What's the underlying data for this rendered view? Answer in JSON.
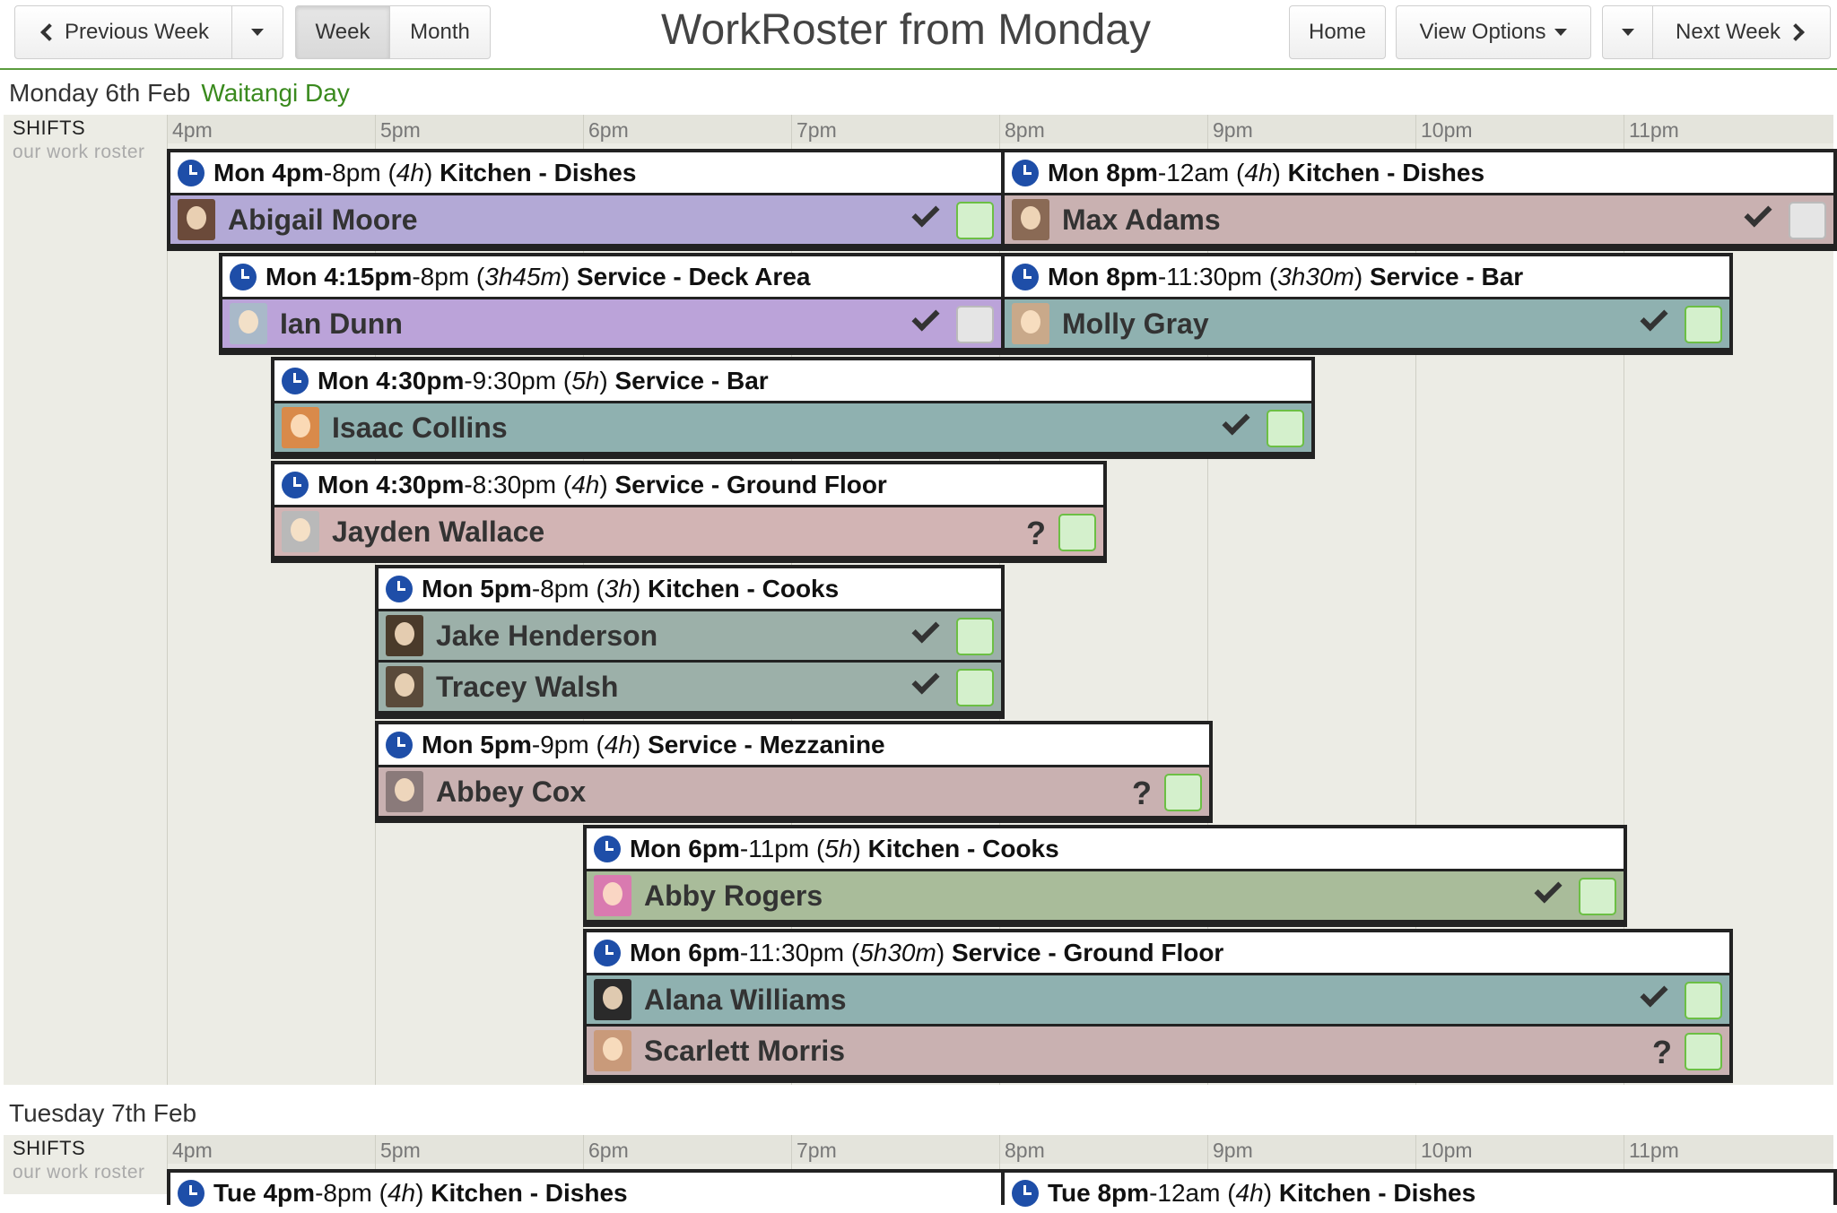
{
  "toolbar": {
    "prev_week": "Previous Week",
    "week": "Week",
    "month": "Month",
    "title": "WorkRoster from Monday",
    "home": "Home",
    "view_options": "View Options",
    "next_week": "Next Week"
  },
  "timeline": {
    "shifts_label": "SHIFTS",
    "roster_sub": "our work roster",
    "hours": [
      "4pm",
      "5pm",
      "6pm",
      "7pm",
      "8pm",
      "9pm",
      "10pm",
      "11pm"
    ]
  },
  "days": [
    {
      "date": "Monday 6th Feb",
      "holiday": "Waitangi Day",
      "shifts": [
        {
          "start": "Mon 4pm",
          "end": "-8pm",
          "duration": "4h",
          "area": "Kitchen - Dishes",
          "staff": [
            {
              "name": "Abigail Moore",
              "status": "confirmed",
              "avatar_color": "#6b4a3a"
            }
          ]
        },
        {
          "start": "Mon 8pm",
          "end": "-12am",
          "duration": "4h",
          "area": "Kitchen - Dishes",
          "staff": [
            {
              "name": "Max Adams",
              "status": "confirmed",
              "avatar_color": "#8a6a55"
            }
          ]
        },
        {
          "start": "Mon 4:15pm",
          "end": "-8pm",
          "duration": "3h45m",
          "area": "Service - Deck Area",
          "staff": [
            {
              "name": "Ian Dunn",
              "status": "confirmed",
              "avatar_color": "#a9b9c9"
            }
          ]
        },
        {
          "start": "Mon 8pm",
          "end": "-11:30pm",
          "duration": "3h30m",
          "area": "Service - Bar",
          "staff": [
            {
              "name": "Molly Gray",
              "status": "confirmed",
              "avatar_color": "#c9a98a"
            }
          ]
        },
        {
          "start": "Mon 4:30pm",
          "end": "-9:30pm",
          "duration": "5h",
          "area": "Service - Bar",
          "staff": [
            {
              "name": "Isaac Collins",
              "status": "confirmed",
              "avatar_color": "#d98a4a"
            }
          ]
        },
        {
          "start": "Mon 4:30pm",
          "end": "-8:30pm",
          "duration": "4h",
          "area": "Service - Ground Floor",
          "staff": [
            {
              "name": "Jayden Wallace",
              "status": "unconfirmed",
              "avatar_color": "#b9b9b9"
            }
          ]
        },
        {
          "start": "Mon 5pm",
          "end": "-8pm",
          "duration": "3h",
          "area": "Kitchen - Cooks",
          "staff": [
            {
              "name": "Jake Henderson",
              "status": "confirmed",
              "avatar_color": "#4a3a2a"
            },
            {
              "name": "Tracey Walsh",
              "status": "confirmed",
              "avatar_color": "#5a4a3a"
            }
          ]
        },
        {
          "start": "Mon 5pm",
          "end": "-9pm",
          "duration": "4h",
          "area": "Service - Mezzanine",
          "staff": [
            {
              "name": "Abbey Cox",
              "status": "unconfirmed",
              "avatar_color": "#8a7a7a"
            }
          ]
        },
        {
          "start": "Mon 6pm",
          "end": "-11pm",
          "duration": "5h",
          "area": "Kitchen - Cooks",
          "staff": [
            {
              "name": "Abby Rogers",
              "status": "confirmed",
              "avatar_color": "#d97ab0"
            }
          ]
        },
        {
          "start": "Mon 6pm",
          "end": "-11:30pm",
          "duration": "5h30m",
          "area": "Service - Ground Floor",
          "staff": [
            {
              "name": "Alana Williams",
              "status": "confirmed",
              "avatar_color": "#2a2a2a"
            },
            {
              "name": "Scarlett Morris",
              "status": "unconfirmed",
              "avatar_color": "#c99a7a"
            }
          ]
        }
      ]
    },
    {
      "date": "Tuesday 7th Feb",
      "holiday": "",
      "shifts": [
        {
          "start": "Tue 4pm",
          "end": "-8pm",
          "duration": "4h",
          "area": "Kitchen - Dishes",
          "staff": []
        },
        {
          "start": "Tue 8pm",
          "end": "-12am",
          "duration": "4h",
          "area": "Kitchen - Dishes",
          "staff": []
        }
      ]
    }
  ],
  "status_glyphs": {
    "unconfirmed": "?"
  },
  "colors": {
    "accent_green": "#5b9c3d",
    "clock_blue": "#1e4ea8",
    "confirm_box": "#d4f0cc"
  }
}
